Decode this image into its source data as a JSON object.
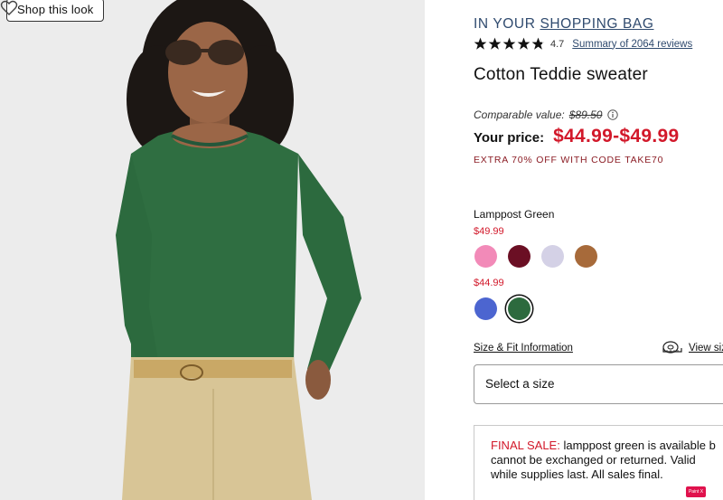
{
  "photo": {
    "shop_look_label": "Shop this look"
  },
  "product": {
    "bag_prefix": "IN YOUR",
    "bag_link": "SHOPPING BAG",
    "rating_value": "4.7",
    "rating_summary": "Summary of 2064 reviews",
    "title": "Cotton Teddie sweater",
    "comparable_label": "Comparable value:",
    "comparable_price": "$89.50",
    "your_price_label": "Your price:",
    "your_price_value": "$44.99-$49.99",
    "promo": "EXTRA 70% OFF WITH CODE TAKE70"
  },
  "colors": {
    "selected_name": "Lamppost Green",
    "groups": [
      {
        "price": "$49.99",
        "swatches": [
          "#f28ab8",
          "#6b0f24",
          "#d4d1e6",
          "#a76a3a"
        ]
      },
      {
        "price": "$44.99",
        "swatches": [
          "#4c65d0",
          "#2c6a3e"
        ]
      }
    ]
  },
  "size": {
    "fit_link": "Size & Fit Information",
    "view_size_link": "View siz",
    "select_label": "Select a size"
  },
  "notice": {
    "label": "FINAL SALE:",
    "line1": "lamppost green is available b",
    "line2": "cannot be exchanged or returned. Valid",
    "line3": "while supplies last. All sales final."
  },
  "badge": {
    "text": "Paint X Lite"
  },
  "theme": {
    "price_red": "#d2182a",
    "link_blue": "#2f4a6e",
    "promo_red": "#8b1c24"
  }
}
